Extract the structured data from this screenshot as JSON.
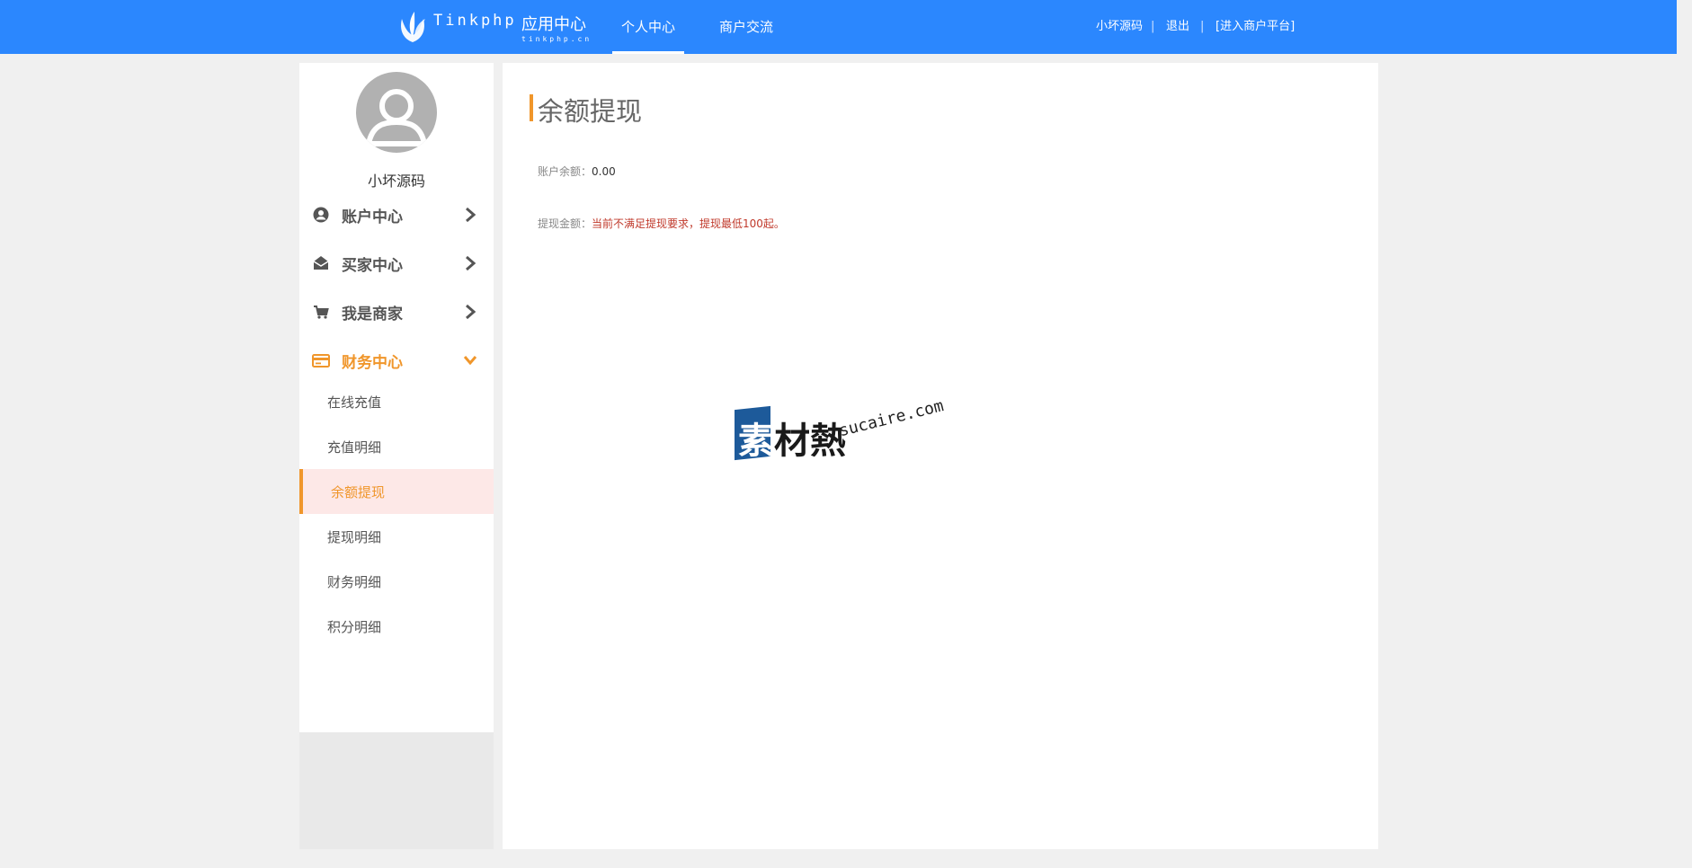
{
  "header": {
    "logo_name": "Tinkphp",
    "logo_subtitle": "应用中心",
    "logo_domain": "tinkphp.cn",
    "tabs": [
      {
        "label": "个人中心",
        "active": true
      },
      {
        "label": "商户交流",
        "active": false
      }
    ],
    "links": {
      "user": "小坏源码",
      "logout": "退出",
      "merchant": "[进入商户平台]",
      "separator": "|"
    }
  },
  "sidebar": {
    "username": "小坏源码",
    "groups": [
      {
        "label": "账户中心",
        "icon": "user-circle-icon",
        "expanded": false
      },
      {
        "label": "买家中心",
        "icon": "envelope-open-icon",
        "expanded": false
      },
      {
        "label": "我是商家",
        "icon": "cart-icon",
        "expanded": false
      },
      {
        "label": "财务中心",
        "icon": "credit-card-icon",
        "expanded": true
      }
    ],
    "finance_items": [
      {
        "label": "在线充值",
        "active": false
      },
      {
        "label": "充值明细",
        "active": false
      },
      {
        "label": "余额提现",
        "active": true
      },
      {
        "label": "提现明细",
        "active": false
      },
      {
        "label": "财务明细",
        "active": false
      },
      {
        "label": "积分明细",
        "active": false
      }
    ]
  },
  "main": {
    "title": "余额提现",
    "balance_label": "账户余额：",
    "balance_value": "0.00",
    "withdraw_label": "提现金额：",
    "withdraw_notice": "当前不满足提现要求，提现最低100起。"
  },
  "watermark": {
    "cn_first": "素",
    "cn_rest": "材熱",
    "en": "sucaire.com"
  },
  "colors": {
    "nav_blue": "#2b87fe",
    "accent_orange": "#f0962b",
    "warn_red": "#c0392b",
    "active_bg": "#fde8e7"
  }
}
